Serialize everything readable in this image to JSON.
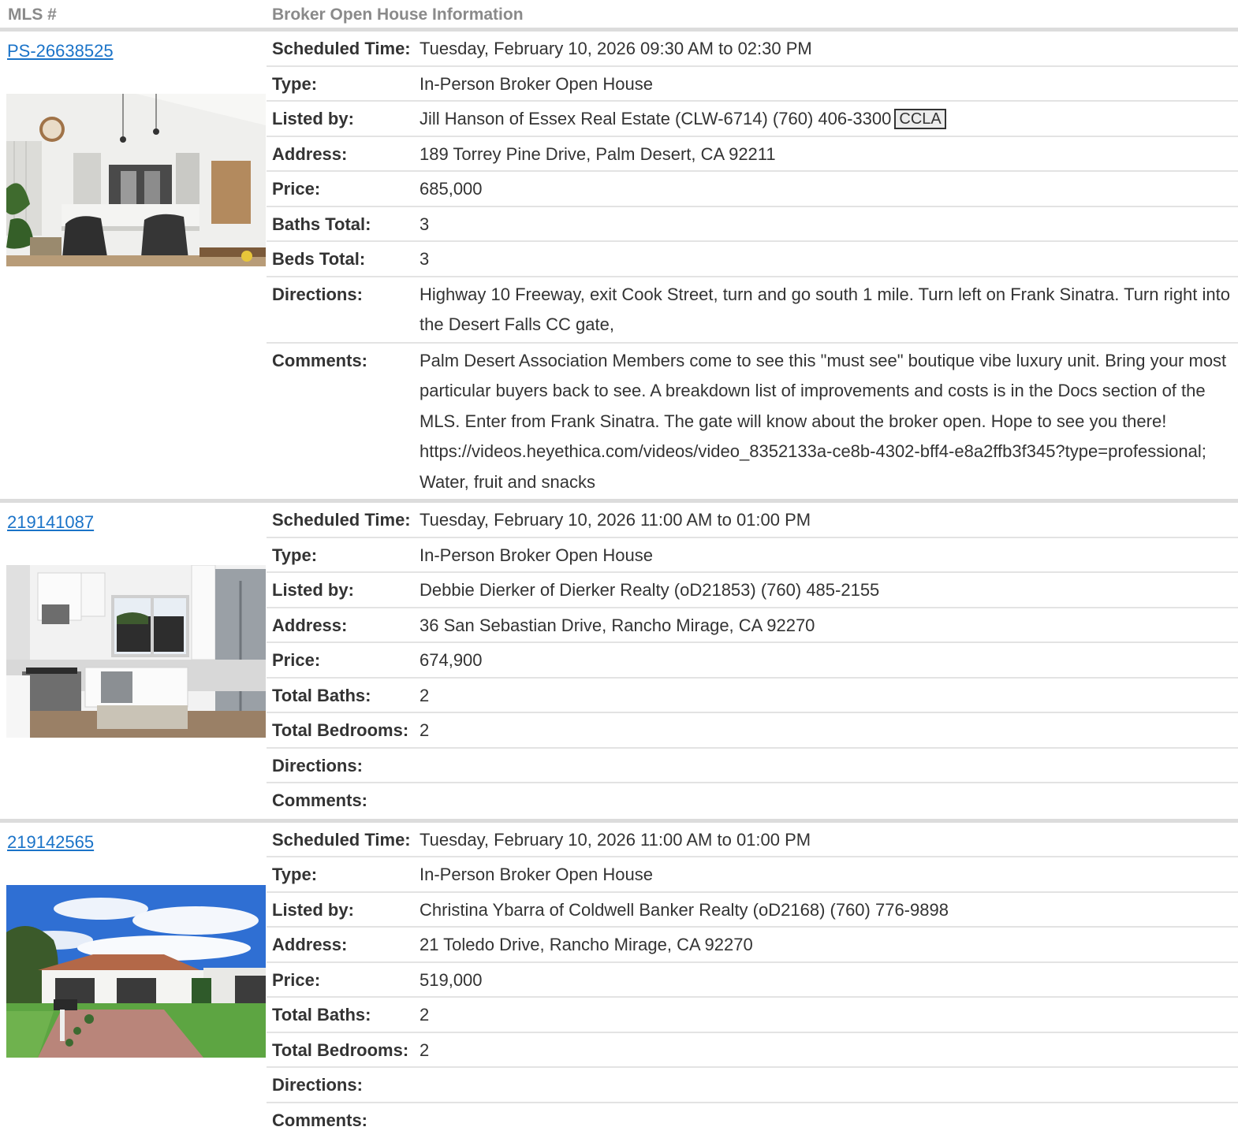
{
  "header": {
    "mls_label": "MLS #",
    "info_label": "Broker Open House Information"
  },
  "listings": [
    {
      "mls": "PS-26638525",
      "photo": "kitchen-living-room-photo",
      "fields": [
        {
          "label": "Scheduled Time:",
          "value": "Tuesday, February 10, 2026 09:30 AM to 02:30 PM"
        },
        {
          "label": "Type:",
          "value": "In-Person Broker Open House"
        },
        {
          "label": "Listed by:",
          "value": "Jill Hanson of Essex Real Estate (CLW-6714) (760) 406-3300",
          "badge": "CCLA"
        },
        {
          "label": "Address:",
          "value": "189 Torrey Pine Drive, Palm Desert, CA 92211"
        },
        {
          "label": "Price:",
          "value": "685,000"
        },
        {
          "label": "Baths Total:",
          "value": "3"
        },
        {
          "label": "Beds Total:",
          "value": "3"
        },
        {
          "label": "Directions:",
          "value": "Highway 10 Freeway, exit Cook Street, turn and go south 1 mile. Turn left on Frank Sinatra. Turn right into the Desert Falls CC gate,"
        },
        {
          "label": "Comments:",
          "value": "Palm Desert Association Members come to see this \"must see\" boutique vibe luxury unit. Bring your most particular buyers back to see. A breakdown list of improvements and costs is in the Docs section of the MLS. Enter from Frank Sinatra. The gate will know about the broker open. Hope to see you there! https://videos.heyethica.com/videos/video_8352133a-ce8b-4302-bff4-e8a2ffb3f345?type=professional; Water, fruit and snacks"
        }
      ]
    },
    {
      "mls": "219141087",
      "photo": "white-kitchen-photo",
      "fields": [
        {
          "label": "Scheduled Time:",
          "value": "Tuesday, February 10, 2026 11:00 AM to 01:00 PM"
        },
        {
          "label": "Type:",
          "value": "In-Person Broker Open House"
        },
        {
          "label": "Listed by:",
          "value": "Debbie Dierker of Dierker Realty (oD21853) (760) 485-2155"
        },
        {
          "label": "Address:",
          "value": "36 San Sebastian Drive, Rancho Mirage, CA 92270"
        },
        {
          "label": "Price:",
          "value": "674,900"
        },
        {
          "label": "Total Baths:",
          "value": "2"
        },
        {
          "label": "Total Bedrooms:",
          "value": "2"
        },
        {
          "label": "Directions:",
          "value": ""
        },
        {
          "label": "Comments:",
          "value": ""
        }
      ]
    },
    {
      "mls": "219142565",
      "photo": "house-exterior-photo",
      "fields": [
        {
          "label": "Scheduled Time:",
          "value": "Tuesday, February 10, 2026 11:00 AM to 01:00 PM"
        },
        {
          "label": "Type:",
          "value": "In-Person Broker Open House"
        },
        {
          "label": "Listed by:",
          "value": "Christina Ybarra of Coldwell Banker Realty (oD2168) (760) 776-9898"
        },
        {
          "label": "Address:",
          "value": "21 Toledo Drive, Rancho Mirage, CA 92270"
        },
        {
          "label": "Price:",
          "value": "519,000"
        },
        {
          "label": "Total Baths:",
          "value": "2"
        },
        {
          "label": "Total Bedrooms:",
          "value": "2"
        },
        {
          "label": "Directions:",
          "value": ""
        },
        {
          "label": "Comments:",
          "value": ""
        }
      ]
    }
  ]
}
